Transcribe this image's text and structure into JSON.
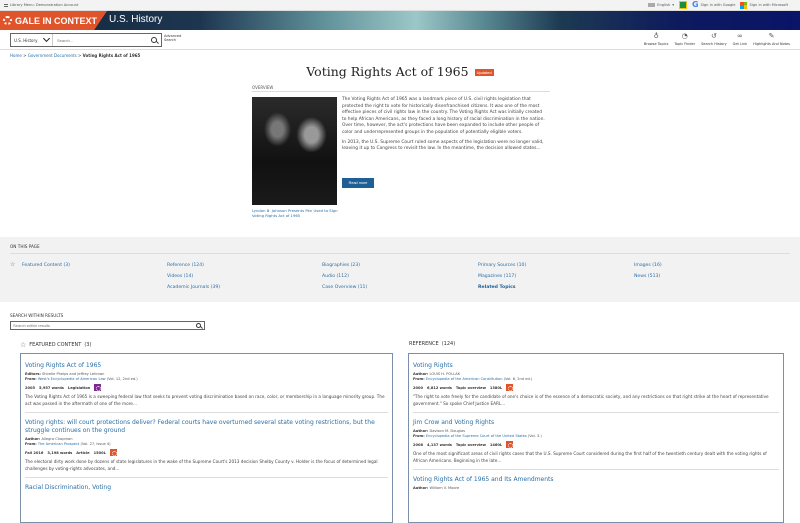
{
  "utility": {
    "account_label": "Library Menu: Demonstration Account",
    "language": "English",
    "sign_in_google": "Sign in with Google",
    "sign_in_microsoft": "Sign in with Microsoft"
  },
  "banner": {
    "brand": "GALE IN CONTEXT",
    "product": "U.S. History"
  },
  "search": {
    "scope": "U.S. History",
    "placeholder": "Search...",
    "advanced_label": "Advanced Search"
  },
  "tools": [
    {
      "icon": "lightbulb-icon",
      "label": "Browse Topics"
    },
    {
      "icon": "topic-finder-icon",
      "label": "Topic Finder"
    },
    {
      "icon": "history-icon",
      "label": "Search History"
    },
    {
      "icon": "link-icon",
      "label": "Get Link"
    },
    {
      "icon": "pencil-icon",
      "label": "Highlights And Notes"
    }
  ],
  "breadcrumb": {
    "home": "Home",
    "parent": "Government Documents",
    "current": "Voting Rights Act of 1965"
  },
  "overview": {
    "title": "Voting Rights Act of 1965",
    "badge": "Updated",
    "section_label": "OVERVIEW",
    "image_caption": "Lyndon B. Johnson Presents Pen Used to Sign Voting Rights Act of 1965",
    "paragraph_1": "The Voting Rights Act of 1965 was a landmark piece of U.S. civil rights legislation that protected the right to vote for historically disenfranchised citizens. It was one of the most effective pieces of civil rights law in the country. The Voting Rights Act was initially created to help African Americans, as they faced a long history of racial discrimination in the nation. Over time, however, the act's protections have been expanded to include other people of color and underrepresented groups in the population of potentially eligible voters.",
    "paragraph_2": "In 2013, the U.S. Supreme Court ruled some aspects of the legislation were no longer valid, leaving it up to Congress to revisit the law. In the meantime, the decision allowed states...",
    "read_more": "Read more"
  },
  "on_this_page": {
    "label": "ON THIS PAGE",
    "links": [
      {
        "label": "Featured Content  (3)"
      },
      {
        "label": "Reference  (124)"
      },
      {
        "label": "Videos  (14)"
      },
      {
        "label": "Academic Journals  (39)"
      },
      {
        "label": "Biographies  (23)"
      },
      {
        "label": "Audio  (112)"
      },
      {
        "label": "Case Overview  (11)"
      },
      {
        "label": "Primary Sources  (10)"
      },
      {
        "label": "Magazines  (117)"
      },
      {
        "label": "Related Topics"
      },
      {
        "label": "Images  (16)"
      },
      {
        "label": "News  (513)"
      }
    ]
  },
  "search_within": {
    "label": "SEARCH WITHIN RESULTS",
    "placeholder": "Search within results"
  },
  "featured": {
    "heading": "FEATURED CONTENT",
    "count": "(3)",
    "items": [
      {
        "title": "Voting Rights Act of 1965",
        "role": "Editors:",
        "people": "Shirelle Phelps and Jeffrey Lehman",
        "from_label": "From:",
        "source": "West's Encyclopedia of American Law",
        "source_detail": "(Vol. 12, 2nd ed.)",
        "year": "2005",
        "words": "5,957 words",
        "type": "Legislation",
        "lexile": "",
        "snippet": "The Voting Rights Act of 1965 is a sweeping federal law that seeks to prevent voting discrimination based on race, color, or membership in a language minority group. The act was passed in the aftermath of one of the more..."
      },
      {
        "title": "Voting rights: will court protections deliver? Federal courts have overturned several state voting restrictions, but the struggle continues on the ground",
        "role": "Author:",
        "people": "Allegra Chapman",
        "from_label": "From:",
        "source": "The American Prospect",
        "source_detail": "(Vol. 27, Issue 4)",
        "year": "Fall 2016",
        "words": "3,198 words",
        "type": "Article",
        "lexile": "1500L",
        "snippet": "The electoral dirty work done by dozens of state legislatures in the wake of the Supreme Court's 2013 decision Shelby County v. Holder is the focus of determined legal challenges by voting-rights advocates, and..."
      },
      {
        "title": "Racial Discrimination, Voting"
      }
    ]
  },
  "reference": {
    "heading": "REFERENCE",
    "count": "(124)",
    "items": [
      {
        "title": "Voting Rights",
        "role": "Author:",
        "people": "LOUIS H. POLLAK",
        "from_label": "From:",
        "source": "Encyclopedia of the American Constitution",
        "source_detail": "(Vol. 6, 2nd ed.)",
        "year": "2000",
        "words": "6,812 words",
        "type": "Topic overview",
        "lexile": "1380L",
        "snippet": "\"The right to vote freely for the candidate of one's choice is of the essence of a democratic society, and any restrictions on that right strike at the heart of representative government.\" So spoke Chief Justice EARL..."
      },
      {
        "title": "Jim Crow and Voting Rights",
        "role": "Author:",
        "people": "Davison M. Douglas",
        "from_label": "From:",
        "source": "Encyclopedia of the Supreme Court of the United States",
        "source_detail": "(Vol. 3.)",
        "year": "2008",
        "words": "4,137 words",
        "type": "Topic overview",
        "lexile": "1460L",
        "snippet": "One of the most significant areas of civil rights cases that the U.S. Supreme Court considered during the first half of the twentieth century dealt with the voting rights of African Americans. Beginning in the late..."
      },
      {
        "title": "Voting Rights Act of 1965 and Its Amendments",
        "role": "Author:",
        "people": "William V. Moore"
      }
    ]
  }
}
